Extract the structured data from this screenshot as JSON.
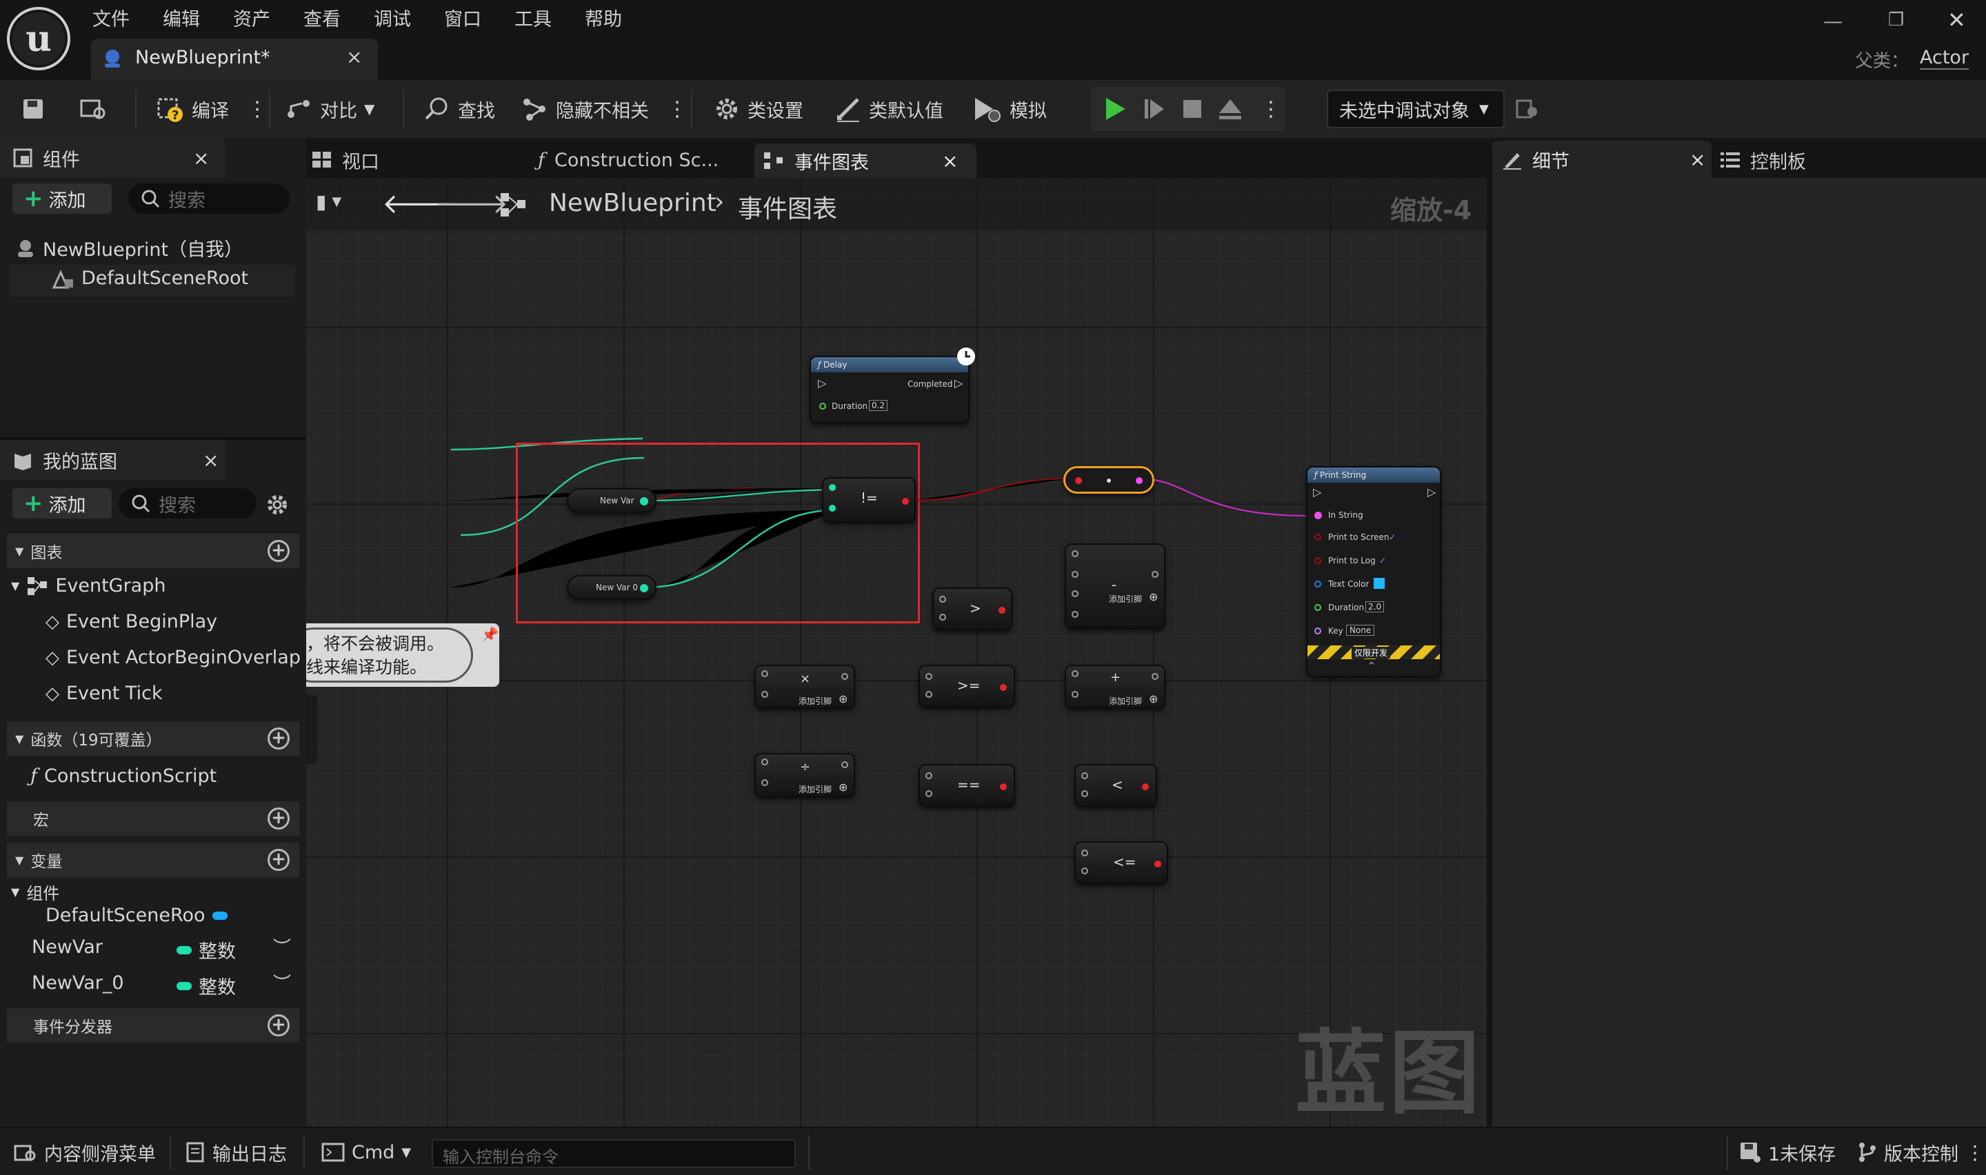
{
  "app": {
    "title": "NewBlueprint*",
    "parent_label": "父类：",
    "parent_value": "Actor"
  },
  "menu": [
    "文件",
    "编辑",
    "资产",
    "查看",
    "调试",
    "窗口",
    "工具",
    "帮助"
  ],
  "toolbar": {
    "compile": "编译",
    "diff": "对比",
    "find": "查找",
    "hide_unrelated": "隐藏不相关",
    "class_settings": "类设置",
    "class_defaults": "类默认值",
    "simulate": "模拟",
    "debug_target": "未选中调试对象"
  },
  "components": {
    "tab": "组件",
    "add": "添加",
    "search_placeholder": "搜索",
    "self": "NewBlueprint（自我）",
    "root": "DefaultSceneRoot"
  },
  "my_blueprint": {
    "tab": "我的蓝图",
    "add": "添加",
    "search_placeholder": "搜索",
    "graphs": "图表",
    "event_graph": "EventGraph",
    "events": [
      "Event BeginPlay",
      "Event ActorBeginOverlap",
      "Event Tick"
    ],
    "functions": "函数（19可覆盖）",
    "construction_script": "ConstructionScript",
    "macros": "宏",
    "variables": "变量",
    "components_group": "组件",
    "scene_root_var": "DefaultSceneRoo",
    "vars": [
      {
        "name": "NewVar",
        "type": "整数"
      },
      {
        "name": "NewVar_0",
        "type": "整数"
      }
    ],
    "dispatchers": "事件分发器"
  },
  "center_tabs": {
    "viewport": "视口",
    "construction": "Construction Sc...",
    "event_graph": "事件图表"
  },
  "breadcrumb": {
    "root": "NewBlueprint",
    "current": "事件图表",
    "zoom": "缩放-4"
  },
  "right_tabs": {
    "details": "细节",
    "palette": "控制板"
  },
  "graph": {
    "watermark": "蓝图",
    "comment_lines": [
      "，将不会被调用。",
      "线来编译功能。"
    ],
    "delay": {
      "title": "Delay",
      "completed": "Completed",
      "duration": "Duration",
      "duration_val": "0.2"
    },
    "print": {
      "title": "Print String",
      "in_string": "In String",
      "to_screen": "Print to Screen",
      "to_log": "Print to Log",
      "text_color": "Text Color",
      "duration": "Duration",
      "duration_val": "2.0",
      "key": "Key",
      "key_val": "None",
      "dev_only": "仅限开发"
    },
    "newvar": "New Var",
    "newvar0": "New Var 0",
    "ops": {
      "neq": "!=",
      "gt": ">",
      "gte": ">=",
      "eq": "==",
      "lt": "<",
      "lte": "<=",
      "mul": "×",
      "div": "÷",
      "sub": "-",
      "add": "+"
    },
    "add_pin": "添加引脚"
  },
  "status": {
    "content_drawer": "内容侧滑菜单",
    "output_log": "输出日志",
    "cmd": "Cmd",
    "console_placeholder": "输入控制台命令",
    "unsaved": "1未保存",
    "source_control": "版本控制"
  },
  "colors": {
    "accent_green": "#2ec27e",
    "int_pin": "#1fe0ad",
    "string_pin": "#f24df0",
    "exec": "#ffffff",
    "selection_red": "#e0282c",
    "bool_pin": "#9b0f0f"
  }
}
